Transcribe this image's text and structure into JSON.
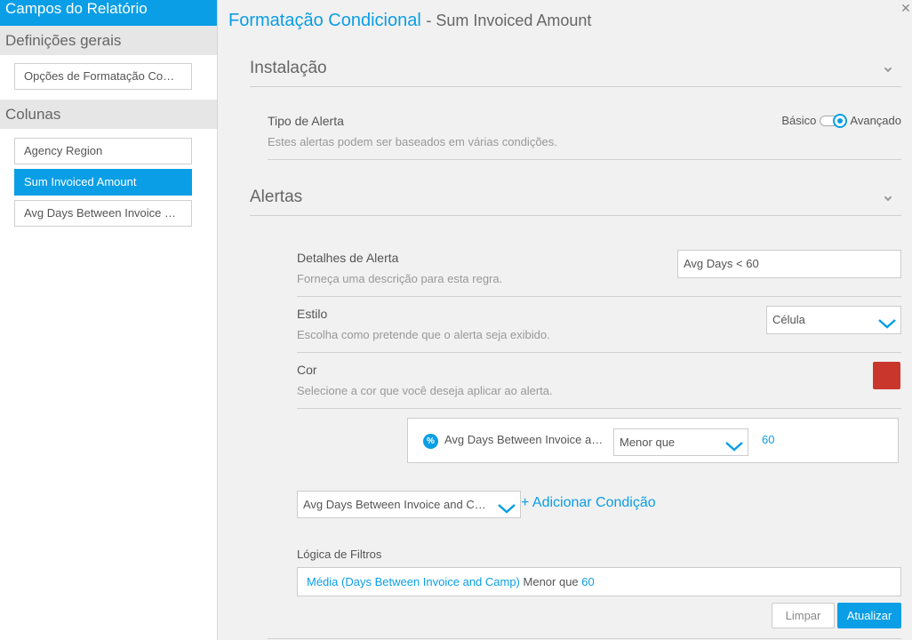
{
  "sidebar": {
    "header": "Campos do Relatório",
    "general_title": "Definições gerais",
    "general_items": [
      "Opções de Formatação Co…"
    ],
    "columns_title": "Colunas",
    "columns_items": [
      "Agency Region",
      "Sum Invoiced Amount",
      "Avg Days Between Invoice …"
    ]
  },
  "main": {
    "title": "Formatação Condicional",
    "subtitle": "- Sum Invoiced Amount",
    "setup": {
      "title": "Instalação",
      "alert_type_label": "Tipo de Alerta",
      "alert_type_desc": "Estes alertas podem ser baseados em várias condições.",
      "toggle_left": "Básico",
      "toggle_right": "Avançado"
    },
    "alerts": {
      "title": "Alertas",
      "details_label": "Detalhes de Alerta",
      "details_desc": "Forneça uma descrição para esta regra.",
      "details_value": "Avg Days < 60",
      "style_label": "Estilo",
      "style_desc": "Escolha como pretende que o alerta seja exibido.",
      "style_value": "Célula",
      "color_label": "Cor",
      "color_desc": "Selecione a cor que você deseja aplicar ao alerta.",
      "color_value": "#c9372c",
      "condition": {
        "icon": "percent-icon",
        "field": "Avg Days Between Invoice a…",
        "operator": "Menor que",
        "value": "60"
      },
      "field_select": "Avg Days Between Invoice and Ca…",
      "add_condition": "+ Adicionar Condição",
      "filter_logic_label": "Lógica de Filtros",
      "filter_logic": {
        "field": "Média (Days Between Invoice and Camp)",
        "operator": "Menor que",
        "value": "60"
      }
    },
    "buttons": {
      "clear": "Limpar",
      "update": "Atualizar"
    }
  }
}
